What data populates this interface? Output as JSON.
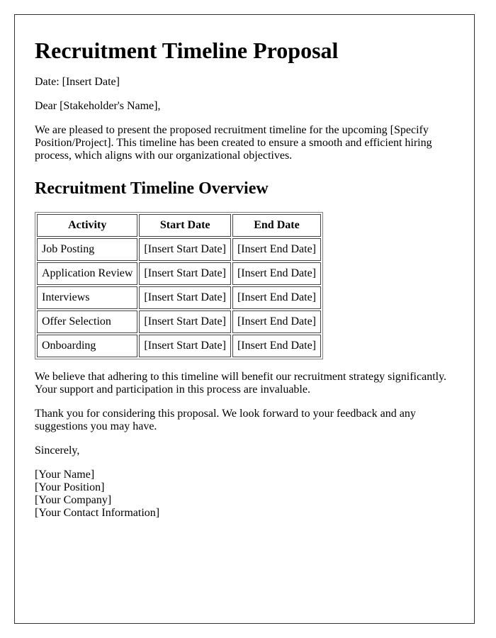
{
  "document": {
    "title": "Recruitment Timeline Proposal",
    "date_line": "Date: [Insert Date]",
    "salutation": "Dear [Stakeholder's Name],",
    "intro": "We are pleased to present the proposed recruitment timeline for the upcoming [Specify Position/Project]. This timeline has been created to ensure a smooth and efficient hiring process, which aligns with our organizational objectives.",
    "section_heading": "Recruitment Timeline Overview",
    "table": {
      "headers": [
        "Activity",
        "Start Date",
        "End Date"
      ],
      "rows": [
        [
          "Job Posting",
          "[Insert Start Date]",
          "[Insert End Date]"
        ],
        [
          "Application Review",
          "[Insert Start Date]",
          "[Insert End Date]"
        ],
        [
          "Interviews",
          "[Insert Start Date]",
          "[Insert End Date]"
        ],
        [
          "Offer Selection",
          "[Insert Start Date]",
          "[Insert End Date]"
        ],
        [
          "Onboarding",
          "[Insert Start Date]",
          "[Insert End Date]"
        ]
      ]
    },
    "body_1": "We believe that adhering to this timeline will benefit our recruitment strategy significantly. Your support and participation in this process are invaluable.",
    "body_2": "Thank you for considering this proposal. We look forward to your feedback and any suggestions you may have.",
    "closing": "Sincerely,",
    "signature": [
      "[Your Name]",
      "[Your Position]",
      "[Your Company]",
      "[Your Contact Information]"
    ]
  }
}
